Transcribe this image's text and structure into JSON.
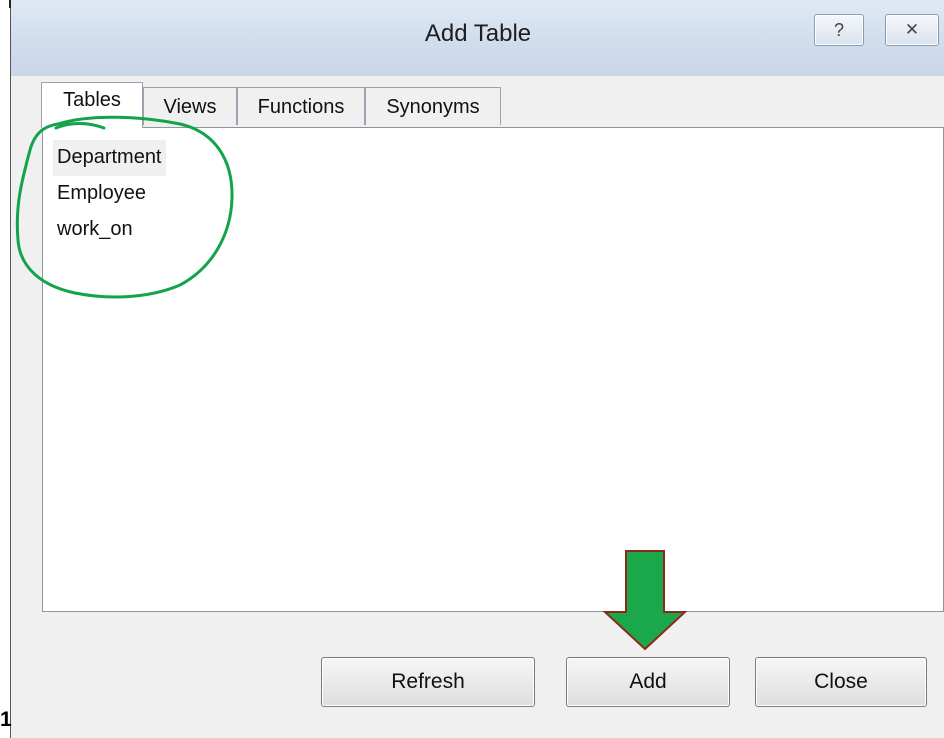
{
  "window": {
    "title": "Add Table",
    "help_glyph": "?",
    "close_glyph": "✕"
  },
  "tabs": [
    {
      "label": "Tables",
      "active": true
    },
    {
      "label": "Views",
      "active": false
    },
    {
      "label": "Functions",
      "active": false
    },
    {
      "label": "Synonyms",
      "active": false
    }
  ],
  "list": {
    "items": [
      {
        "label": "Department",
        "selected": true
      },
      {
        "label": "Employee",
        "selected": false
      },
      {
        "label": "work_on",
        "selected": false
      }
    ]
  },
  "buttons": {
    "refresh": "Refresh",
    "add": "Add",
    "close": "Close"
  },
  "corner_label": "1",
  "annotation": {
    "circle_color": "#13a34a",
    "arrow_fill": "#1aa84a",
    "arrow_stroke": "#8b2a1a"
  }
}
